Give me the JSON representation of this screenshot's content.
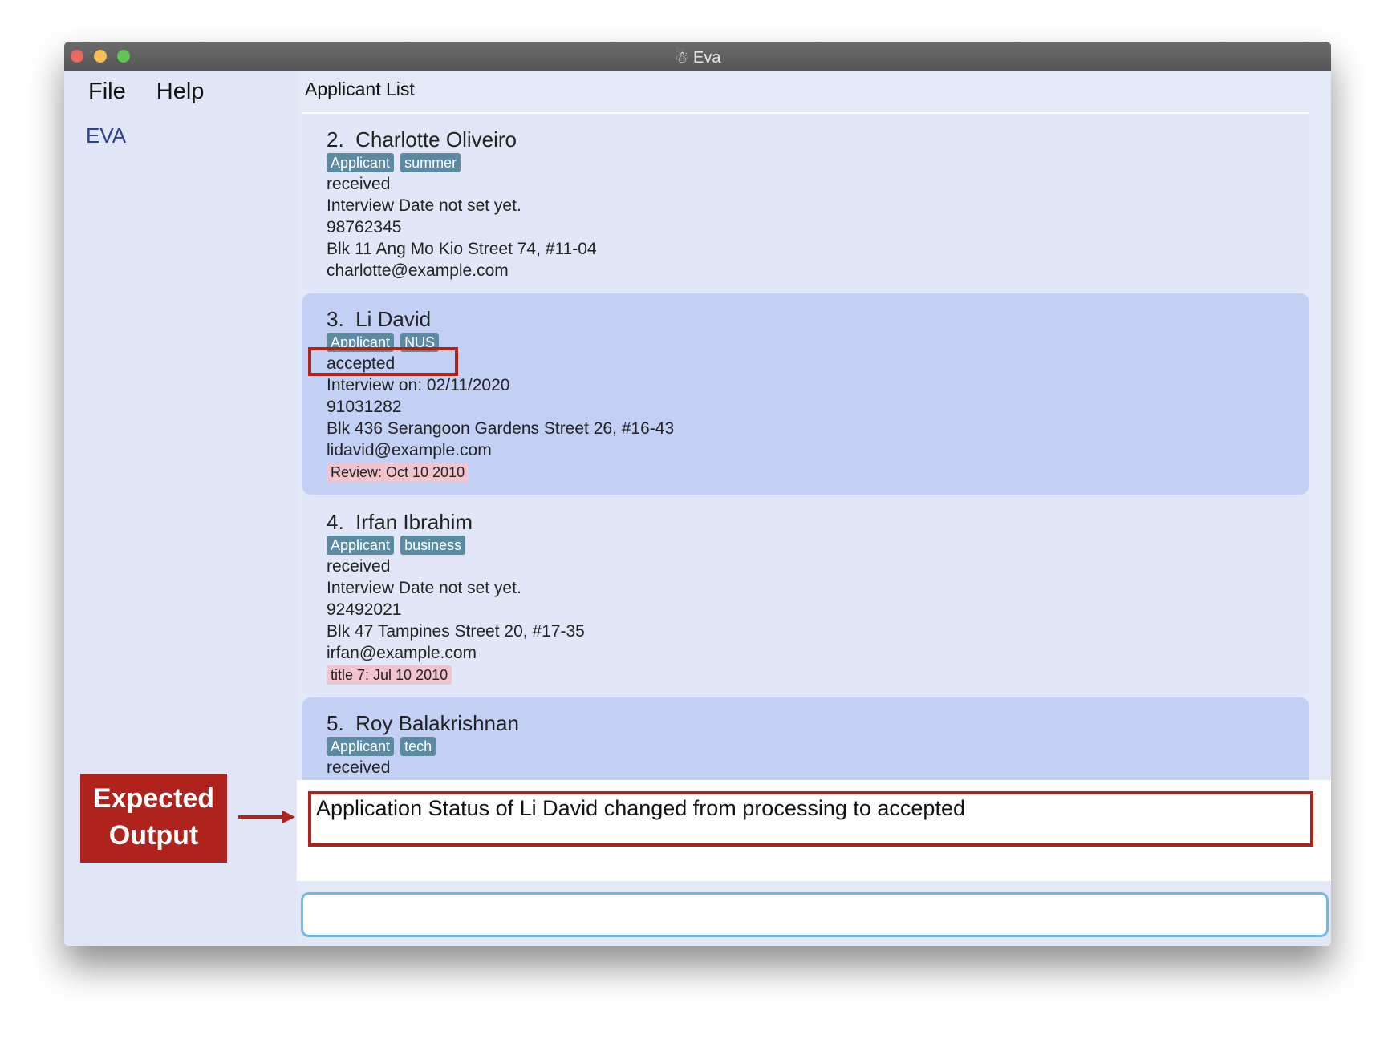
{
  "window": {
    "title": "Eva",
    "controls": {
      "close": "#ed6a5e",
      "minimize": "#f5bf4f",
      "zoom": "#61c554"
    }
  },
  "menu": {
    "file": "File",
    "help": "Help"
  },
  "sidebar": {
    "brand": "EVA"
  },
  "list": {
    "header": "Applicant List",
    "cards": [
      {
        "index": "2.",
        "name": "Charlotte Oliveiro",
        "tags": [
          "Applicant",
          "summer"
        ],
        "status": "received",
        "interview": "Interview Date not set yet.",
        "phone": "98762345",
        "address": "Blk 11 Ang Mo Kio Street 74, #11-04",
        "email": "charlotte@example.com",
        "remark": "",
        "selected": false
      },
      {
        "index": "3.",
        "name": "Li David",
        "tags": [
          "Applicant",
          "NUS"
        ],
        "status": "accepted",
        "interview": "Interview on: 02/11/2020",
        "phone": "91031282",
        "address": "Blk 436 Serangoon Gardens Street 26, #16-43",
        "email": "lidavid@example.com",
        "remark": "Review: Oct 10 2010",
        "selected": true
      },
      {
        "index": "4.",
        "name": "Irfan Ibrahim",
        "tags": [
          "Applicant",
          "business"
        ],
        "status": "received",
        "interview": "Interview Date not set yet.",
        "phone": "92492021",
        "address": "Blk 47 Tampines Street 20, #17-35",
        "email": "irfan@example.com",
        "remark": "title 7: Jul 10 2010",
        "selected": false
      },
      {
        "index": "5.",
        "name": "Roy Balakrishnan",
        "tags": [
          "Applicant",
          "tech"
        ],
        "status": "received",
        "interview": "",
        "phone": "",
        "address": "",
        "email": "",
        "remark": "",
        "selected": true
      }
    ]
  },
  "result": {
    "text": "Application Status of Li David changed from processing to accepted"
  },
  "command": {
    "value": "",
    "placeholder": ""
  },
  "annotation": {
    "line1": "Expected",
    "line2": "Output",
    "color": "#b0231c"
  },
  "colors": {
    "card": "#e1e7f8",
    "card_selected": "#c2d0f3",
    "tag": "#5a8ba3",
    "remark": "#f2c4cf",
    "accent": "#6cb8e8"
  }
}
